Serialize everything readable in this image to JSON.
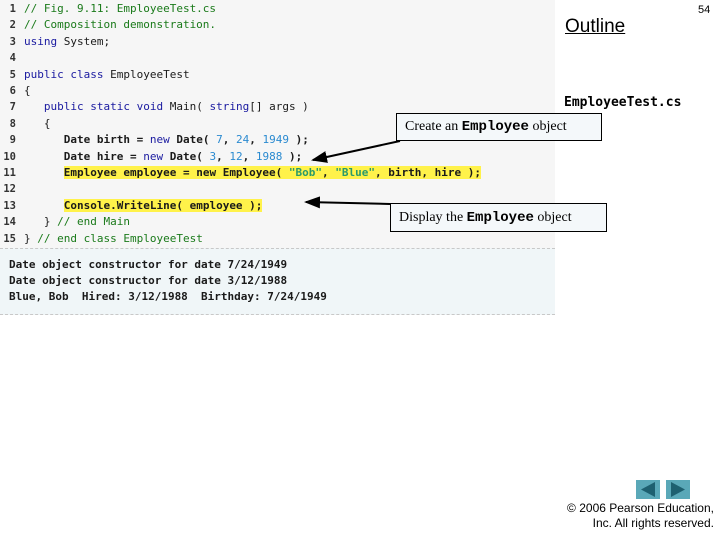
{
  "slide": {
    "page_number": "54",
    "outline_title": "Outline",
    "file_name": "EmployeeTest.cs"
  },
  "code": {
    "lines": [
      {
        "n": "1",
        "segments": [
          {
            "t": "// Fig. 9.11: EmployeeTest.cs",
            "c": "cm"
          }
        ]
      },
      {
        "n": "2",
        "segments": [
          {
            "t": "// Composition demonstration.",
            "c": "cm"
          }
        ]
      },
      {
        "n": "3",
        "segments": [
          {
            "t": "using",
            "c": "kw"
          },
          {
            "t": " System;",
            "c": ""
          }
        ]
      },
      {
        "n": "4",
        "segments": []
      },
      {
        "n": "5",
        "segments": [
          {
            "t": "public class",
            "c": "kw"
          },
          {
            "t": " EmployeeTest",
            "c": ""
          }
        ]
      },
      {
        "n": "6",
        "segments": [
          {
            "t": "{",
            "c": ""
          }
        ]
      },
      {
        "n": "7",
        "segments": [
          {
            "t": "   ",
            "c": ""
          },
          {
            "t": "public static void",
            "c": "kw"
          },
          {
            "t": " Main( ",
            "c": ""
          },
          {
            "t": "string",
            "c": "kw"
          },
          {
            "t": "[] args )",
            "c": ""
          }
        ]
      },
      {
        "n": "8",
        "segments": [
          {
            "t": "   {",
            "c": ""
          }
        ]
      },
      {
        "n": "9",
        "segments": [
          {
            "t": "      Date birth = ",
            "c": "b"
          },
          {
            "t": "new",
            "c": "kw"
          },
          {
            "t": " Date( ",
            "c": "b"
          },
          {
            "t": "7",
            "c": "num"
          },
          {
            "t": ", ",
            "c": "b"
          },
          {
            "t": "24",
            "c": "num"
          },
          {
            "t": ", ",
            "c": "b"
          },
          {
            "t": "1949",
            "c": "num"
          },
          {
            "t": " );",
            "c": "b"
          }
        ]
      },
      {
        "n": "10",
        "segments": [
          {
            "t": "      Date hire = ",
            "c": "b"
          },
          {
            "t": "new",
            "c": "kw"
          },
          {
            "t": " Date( ",
            "c": "b"
          },
          {
            "t": "3",
            "c": "num"
          },
          {
            "t": ", ",
            "c": "b"
          },
          {
            "t": "12",
            "c": "num"
          },
          {
            "t": ", ",
            "c": "b"
          },
          {
            "t": "1988",
            "c": "num"
          },
          {
            "t": " );",
            "c": "b"
          }
        ]
      },
      {
        "n": "11",
        "segments": [
          {
            "t": "      ",
            "c": ""
          },
          {
            "t": "Employee employee = new Employee( ",
            "c": "hl"
          },
          {
            "t": "\"Bob\"",
            "c": "hl str"
          },
          {
            "t": ", ",
            "c": "hl"
          },
          {
            "t": "\"Blue\"",
            "c": "hl str"
          },
          {
            "t": ", birth, hire );",
            "c": "hl"
          }
        ]
      },
      {
        "n": "12",
        "segments": []
      },
      {
        "n": "13",
        "segments": [
          {
            "t": "      ",
            "c": ""
          },
          {
            "t": "Console.WriteLine( employee );",
            "c": "hl"
          }
        ]
      },
      {
        "n": "14",
        "segments": [
          {
            "t": "   } ",
            "c": ""
          },
          {
            "t": "// end Main",
            "c": "cm"
          }
        ]
      },
      {
        "n": "15",
        "segments": [
          {
            "t": "} ",
            "c": ""
          },
          {
            "t": "// end class EmployeeTest",
            "c": "cm"
          }
        ]
      }
    ]
  },
  "output": {
    "lines": [
      "Date object constructor for date 7/24/1949",
      "Date object constructor for date 3/12/1988",
      "Blue, Bob  Hired: 3/12/1988  Birthday: 7/24/1949"
    ]
  },
  "callouts": {
    "create": {
      "before": "Create an ",
      "code": "Employee",
      "after": " object"
    },
    "display": {
      "before": "Display the ",
      "code": "Employee",
      "after": " object"
    }
  },
  "navigation": {
    "prev_icon": "triangle-left",
    "next_icon": "triangle-right",
    "button_color": "#5aa8b8",
    "icon_color": "#1e6070"
  },
  "footer": {
    "copyright_line1": "© 2006 Pearson Education,",
    "copyright_line2": "Inc.  All rights reserved."
  }
}
